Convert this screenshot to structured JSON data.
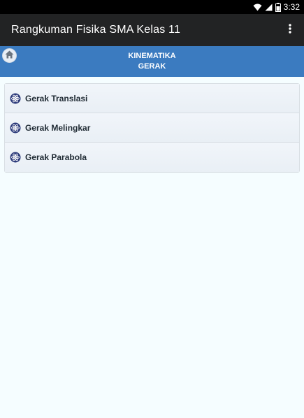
{
  "status_bar": {
    "time": "3:32"
  },
  "app_bar": {
    "title": "Rangkuman Fisika SMA Kelas 11"
  },
  "header": {
    "line1": "KINEMATIKA",
    "line2": "GERAK"
  },
  "list": {
    "items": [
      {
        "label": "Gerak Translasi"
      },
      {
        "label": "Gerak Melingkar"
      },
      {
        "label": "Gerak Parabola"
      }
    ]
  },
  "icons": {
    "overflow": "more-vert-icon",
    "home": "home-icon",
    "item": "atom-icon",
    "wifi": "wifi-icon",
    "signal": "signal-icon",
    "battery": "battery-icon"
  },
  "colors": {
    "app_bar": "#222324",
    "header_band": "#3b7bc0",
    "background": "#f5fdff"
  }
}
